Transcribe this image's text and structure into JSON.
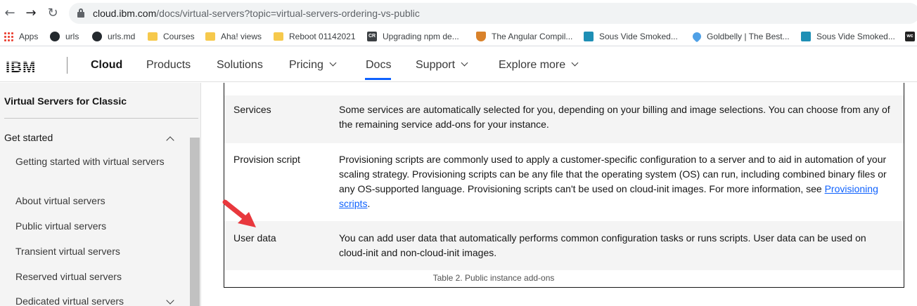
{
  "browser": {
    "url_host": "cloud.ibm.com",
    "url_path": "/docs/virtual-servers?topic=virtual-servers-ordering-vs-public",
    "back_icon": "arrow-left",
    "forward_icon": "arrow-right",
    "reload_icon": "reload"
  },
  "bookmarks": [
    {
      "label": "Apps",
      "icon": "apps-grid"
    },
    {
      "label": "urls",
      "icon": "github"
    },
    {
      "label": "urls.md",
      "icon": "github"
    },
    {
      "label": "Courses",
      "icon": "folder"
    },
    {
      "label": "Aha! views",
      "icon": "folder"
    },
    {
      "label": "Reboot 01142021",
      "icon": "folder"
    },
    {
      "label": "Upgrading npm de...",
      "icon": "cr"
    },
    {
      "label": "The Angular Compil...",
      "icon": "angular"
    },
    {
      "label": "Sous Vide Smoked...",
      "icon": "sous"
    },
    {
      "label": "Goldbelly | The Best...",
      "icon": "rocket"
    },
    {
      "label": "Sous Vide Smoked...",
      "icon": "sous"
    },
    {
      "label": "wc",
      "icon": "wc"
    }
  ],
  "header": {
    "logo": "IBM",
    "brand": "Cloud",
    "nav": [
      "Products",
      "Solutions",
      "Pricing",
      "Docs",
      "Support",
      "Explore more"
    ],
    "active": "Docs",
    "accent": "#0f62fe"
  },
  "sidebar": {
    "title": "Virtual Servers for Classic",
    "section": "Get started",
    "items": [
      "Getting started with virtual servers",
      "About virtual servers",
      "Public virtual servers",
      "Transient virtual servers",
      "Reserved virtual servers",
      "Dedicated virtual servers"
    ]
  },
  "table": {
    "rows": [
      {
        "name": "Services",
        "desc": "Some services are automatically selected for you, depending on your billing and image selections. You can choose from any of the remaining service add-ons for your instance."
      },
      {
        "name": "Provision script",
        "desc": "Provisioning scripts are commonly used to apply a customer-specific configuration to a server and to aid in automation of your scaling strategy. Provisioning scripts can be any file that the operating system (OS) can run, including combined binary files or any OS-supported language. Provisioning scripts can't be used on cloud-init images. For more information, see ",
        "link": "Provisioning scripts",
        "after_link": "."
      },
      {
        "name": "User data",
        "desc": "You can add user data that automatically performs common configuration tasks or runs scripts. User data can be used on cloud-init and non-cloud-init images."
      }
    ],
    "caption": "Table 2. Public instance add-ons"
  },
  "annotation": {
    "color": "#e8383d"
  }
}
